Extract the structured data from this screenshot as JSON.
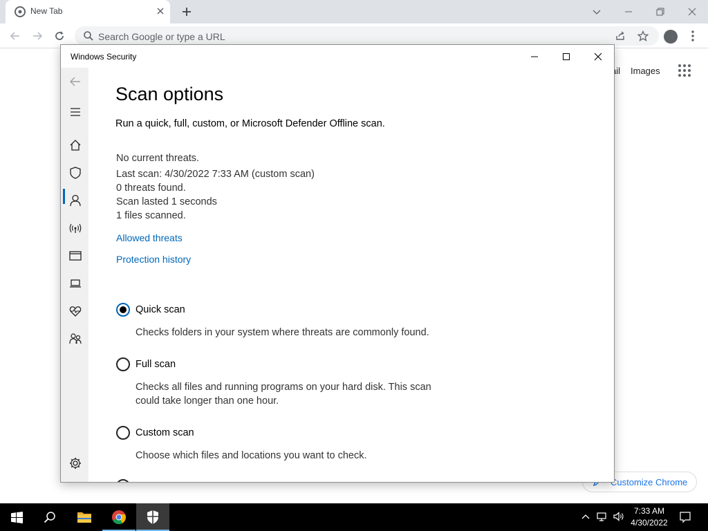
{
  "browser": {
    "tab_title": "New Tab",
    "omnibox_placeholder": "Search Google or type a URL",
    "ntp_gmail_partial": "ail",
    "ntp_images": "Images",
    "customize_label": "Customize Chrome"
  },
  "dialog": {
    "title": "Windows Security",
    "page_title": "Scan options",
    "subtitle": "Run a quick, full, custom, or Microsoft Defender Offline scan.",
    "status": {
      "current": "No current threats.",
      "last_scan": "Last scan: 4/30/2022 7:33 AM (custom scan)",
      "threats_found": "0 threats found.",
      "duration": "Scan lasted 1 seconds",
      "files": "1 files scanned."
    },
    "links": {
      "allowed": "Allowed threats",
      "history": "Protection history"
    },
    "scan_options": [
      {
        "label": "Quick scan",
        "description": "Checks folders in your system where threats are commonly found.",
        "selected": true
      },
      {
        "label": "Full scan",
        "description": "Checks all files and running programs on your hard disk. This scan could take longer than one hour.",
        "selected": false
      },
      {
        "label": "Custom scan",
        "description": "Choose which files and locations you want to check.",
        "selected": false
      }
    ],
    "sidebar_icons": [
      "back-icon",
      "menu-icon",
      "home-icon",
      "shield-icon",
      "person-icon",
      "wireless-icon",
      "app-browser-icon",
      "laptop-icon",
      "heart-icon",
      "family-icon",
      "settings-icon"
    ]
  },
  "taskbar": {
    "time": "7:33 AM",
    "date": "4/30/2022"
  },
  "colors": {
    "accent": "#0067b8",
    "taskbar": "#000000",
    "chrome_frame": "#dee1e6"
  }
}
